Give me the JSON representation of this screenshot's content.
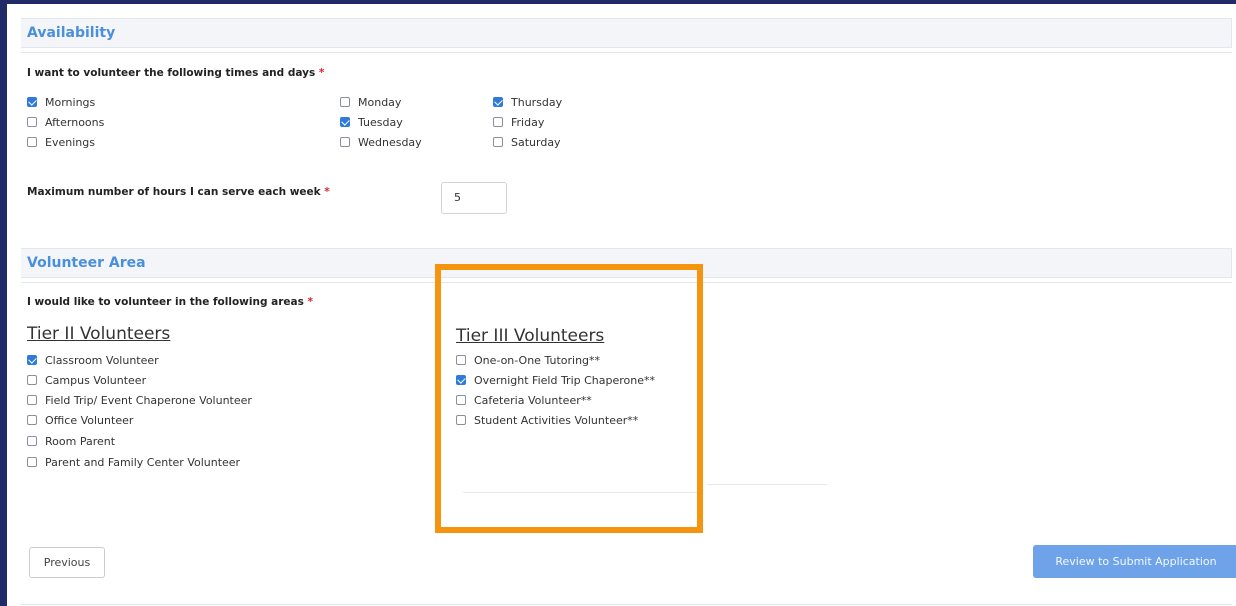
{
  "availability": {
    "header": "Availability",
    "times_question": "I want to volunteer the following times and days",
    "required_mark": "*",
    "times": [
      {
        "label": "Mornings",
        "checked": true
      },
      {
        "label": "Afternoons",
        "checked": false
      },
      {
        "label": "Evenings",
        "checked": false
      }
    ],
    "days_col1": [
      {
        "label": "Monday",
        "checked": false
      },
      {
        "label": "Tuesday",
        "checked": true
      },
      {
        "label": "Wednesday",
        "checked": false
      }
    ],
    "days_col2": [
      {
        "label": "Thursday",
        "checked": true
      },
      {
        "label": "Friday",
        "checked": false
      },
      {
        "label": "Saturday",
        "checked": false
      }
    ],
    "hours_question": "Maximum number of hours I can serve each week",
    "hours_value": "5"
  },
  "volunteer_area": {
    "header": "Volunteer Area",
    "areas_question": "I would like to volunteer in the following areas",
    "tier2": {
      "title": "Tier II Volunteers",
      "items": [
        {
          "label": "Classroom Volunteer",
          "checked": true
        },
        {
          "label": "Campus Volunteer",
          "checked": false
        },
        {
          "label": "Field Trip/ Event Chaperone Volunteer",
          "checked": false
        },
        {
          "label": "Office Volunteer",
          "checked": false
        },
        {
          "label": "Room Parent",
          "checked": false
        },
        {
          "label": "Parent and Family Center Volunteer",
          "checked": false
        }
      ]
    },
    "tier3": {
      "title": "Tier III Volunteers",
      "items": [
        {
          "label": "One-on-One Tutoring**",
          "checked": false
        },
        {
          "label": "Overnight Field Trip Chaperone**",
          "checked": true
        },
        {
          "label": "Cafeteria Volunteer**",
          "checked": false
        },
        {
          "label": "Student Activities Volunteer**",
          "checked": false
        }
      ]
    }
  },
  "buttons": {
    "previous": "Previous",
    "review": "Review to Submit Application"
  },
  "colors": {
    "accent": "#4a8fdc",
    "checkbox_checked": "#2f7bdc",
    "highlight": "#f5940e",
    "required": "#d9232d",
    "frame": "#1f2a66",
    "review_button": "#6ea3ea"
  }
}
